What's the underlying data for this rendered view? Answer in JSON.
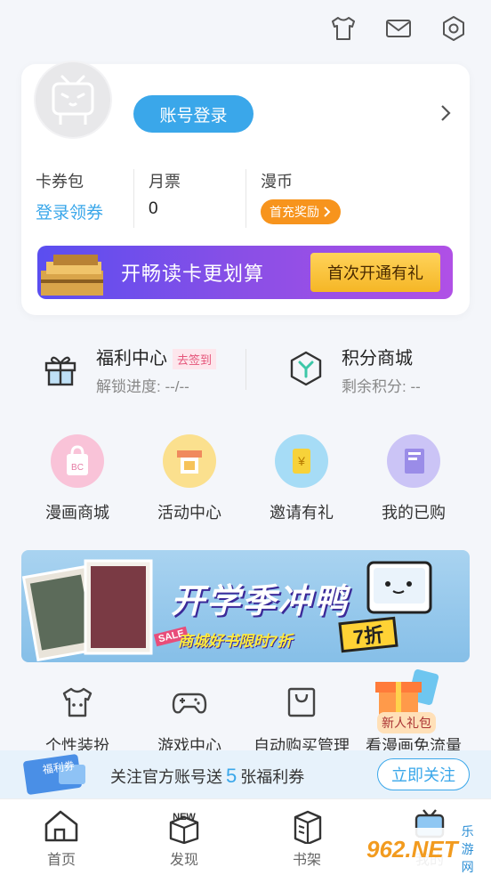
{
  "profile": {
    "login_label": "账号登录",
    "stats": [
      {
        "label": "卡券包",
        "value": "登录领券"
      },
      {
        "label": "月票",
        "value": "0"
      },
      {
        "label": "漫币",
        "value": "首充奖励"
      }
    ],
    "banner": {
      "text": "开畅读卡更划算",
      "button": "首次开通有礼"
    }
  },
  "welfare": {
    "left": {
      "title": "福利中心",
      "tag": "去签到",
      "sub": "解锁进度:  --/--"
    },
    "right": {
      "title": "积分商城",
      "sub": "剩余积分: --"
    }
  },
  "circles": [
    {
      "label": "漫画商城",
      "color": "#f6a9c8",
      "icon": "bag-icon"
    },
    {
      "label": "活动中心",
      "color": "#f8d26a",
      "icon": "stage-icon"
    },
    {
      "label": "邀请有礼",
      "color": "#8fd3f4",
      "icon": "coin-icon"
    },
    {
      "label": "我的已购",
      "color": "#b9b0f2",
      "icon": "book-icon"
    }
  ],
  "promo": {
    "headline": "开学季冲鸭",
    "sale": "SALE",
    "sub": "商城好书限时7折",
    "badge": "7折"
  },
  "tools": [
    {
      "label": "个性装扮",
      "icon": "tshirt-icon"
    },
    {
      "label": "游戏中心",
      "icon": "gamepad-icon"
    },
    {
      "label": "自动购买管理",
      "icon": "shopping-bag-icon"
    },
    {
      "label": "看漫画免流量",
      "icon": "gift-icon"
    }
  ],
  "gift_tag": "新人礼包",
  "follow": {
    "ticket_label": "福利券",
    "text_pre": "关注官方账号送",
    "count": "5",
    "text_post": "张福利券",
    "button": "立即关注"
  },
  "nav": [
    {
      "label": "首页",
      "icon": "home-icon"
    },
    {
      "label": "发现",
      "icon": "new-box-icon"
    },
    {
      "label": "书架",
      "icon": "bookshelf-icon"
    },
    {
      "label": "我的",
      "icon": "profile-tv-icon"
    }
  ],
  "watermark": {
    "main": "962.NET",
    "sub": "乐游网"
  },
  "colors": {
    "accent": "#3aa7ea",
    "orange": "#f7941d",
    "pink_tag": "#e5557a"
  }
}
